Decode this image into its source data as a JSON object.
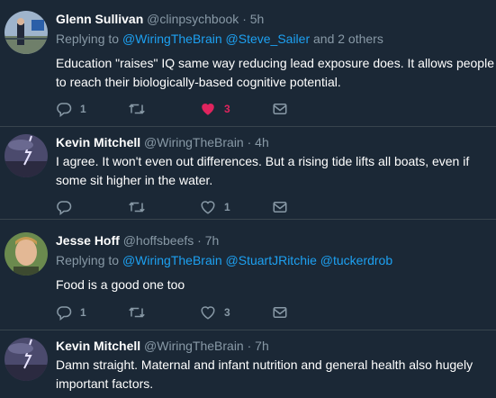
{
  "tweets": [
    {
      "name": "Glenn Sullivan",
      "handle": "@clinpsychbook",
      "dot": "·",
      "time": "5h",
      "replying_prefix": "Replying to",
      "replying_links": [
        "@WiringTheBrain",
        "@Steve_Sailer"
      ],
      "replying_suffix": "and 2 others",
      "text": "Education \"raises\" IQ same way reducing lead exposure does. It allows people to reach their biologically-based cognitive potential.",
      "replies": "1",
      "retweets": "",
      "likes": "3",
      "liked": true
    },
    {
      "name": "Kevin Mitchell",
      "handle": "@WiringTheBrain",
      "dot": "·",
      "time": "4h",
      "text": "I agree. It won't even out differences. But a rising tide lifts all boats, even if some sit higher in the water.",
      "replies": "",
      "retweets": "",
      "likes": "1",
      "liked": false
    },
    {
      "name": "Jesse Hoff",
      "handle": "@hoffsbeefs",
      "dot": "·",
      "time": "7h",
      "replying_prefix": "Replying to",
      "replying_links": [
        "@WiringTheBrain",
        "@StuartJRitchie",
        "@tuckerdrob"
      ],
      "text": "Food is a good one too",
      "replies": "1",
      "retweets": "",
      "likes": "3",
      "liked": false
    },
    {
      "name": "Kevin Mitchell",
      "handle": "@WiringTheBrain",
      "dot": "·",
      "time": "7h",
      "text": "Damn straight. Maternal and infant nutrition and general health also hugely important factors."
    }
  ],
  "icons": {
    "reply": "reply-icon",
    "retweet": "retweet-icon",
    "like": "heart-icon",
    "dm": "envelope-icon"
  },
  "colors": {
    "background": "#1b2836",
    "link": "#1da1f2",
    "muted": "#8899a6",
    "liked": "#e0245e"
  }
}
